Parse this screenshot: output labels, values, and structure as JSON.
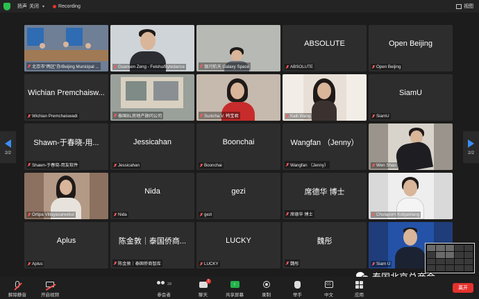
{
  "topbar": {
    "audio_label": "扬声",
    "audio_value": "关闭",
    "recording_label": "Recording",
    "view_label": "视图"
  },
  "navigation": {
    "left_page": "2/2",
    "right_page": "2/2"
  },
  "tiles": [
    {
      "big": "",
      "name": "北京市\"两区\"办/Beijing Municipal ...",
      "video": true
    },
    {
      "big": "",
      "name": "Guansen Zeng - Feishu/Bytedance",
      "video": true
    },
    {
      "big": "",
      "name": "银河航天 Galaxy Space",
      "video": true
    },
    {
      "big": "ABSOLUTE",
      "name": "ABSOLUTE",
      "video": false
    },
    {
      "big": "Open Beijing",
      "name": "Open Beijing",
      "video": false
    },
    {
      "big": "Wichian Premchaisw...",
      "name": "Wichian Premchaiswadi",
      "video": false
    },
    {
      "big": "",
      "name": "泰国BL房地产顾问公司",
      "video": true
    },
    {
      "big": "",
      "name": "Sunicha V. 韩宝君",
      "video": true
    },
    {
      "big": "",
      "name": "Kaili Wang",
      "video": true
    },
    {
      "big": "SiamU",
      "name": "SiamU",
      "video": false
    },
    {
      "big": "Shawn-于春晓-用...",
      "name": "Shawn-于春晓-用友软件",
      "video": false
    },
    {
      "big": "Jessicahan",
      "name": "Jessicahan",
      "video": false
    },
    {
      "big": "Boonchai",
      "name": "Boonchai",
      "video": false
    },
    {
      "big": "Wangfan （Jenny）",
      "name": "Wangfan （Jenny）",
      "video": false
    },
    {
      "big": "",
      "name": "Wen Shao",
      "video": true
    },
    {
      "big": "",
      "name": "Ortipa Vittayasareekul",
      "video": true
    },
    {
      "big": "Nida",
      "name": "Nida",
      "video": false
    },
    {
      "big": "gezi",
      "name": "gezi",
      "video": false
    },
    {
      "big": "席德华 博士",
      "name": "席德华 博士",
      "video": false
    },
    {
      "big": "",
      "name": "Chulaporn Kobjaiklang",
      "video": true
    },
    {
      "big": "Aplus",
      "name": "Aplus",
      "video": false
    },
    {
      "big": "陈金敦｜泰国侨商...",
      "name": "陈金敦｜泰国侨商智库",
      "video": false
    },
    {
      "big": "LUCKY",
      "name": "LUCKY",
      "video": false
    },
    {
      "big": "魏彤",
      "name": "魏彤",
      "video": false
    },
    {
      "big": "",
      "name": "Siam U",
      "video": true
    }
  ],
  "toolbar": {
    "unmute": "解除静音",
    "start_video": "开启视频",
    "participants": "参会者",
    "participants_count": "28",
    "chat": "聊天",
    "chat_badge": "1",
    "share": "共享屏幕",
    "record": "录制",
    "raise_hand": "举手",
    "captions": "中文",
    "apps": "应用",
    "leave": "离开"
  },
  "watermark": {
    "text": "泰国北京总商会"
  },
  "colors": {
    "active_border": "#7fd35a",
    "nav_arrow": "#3a8ef6",
    "leave": "#e5312d",
    "share": "#24b24b"
  }
}
